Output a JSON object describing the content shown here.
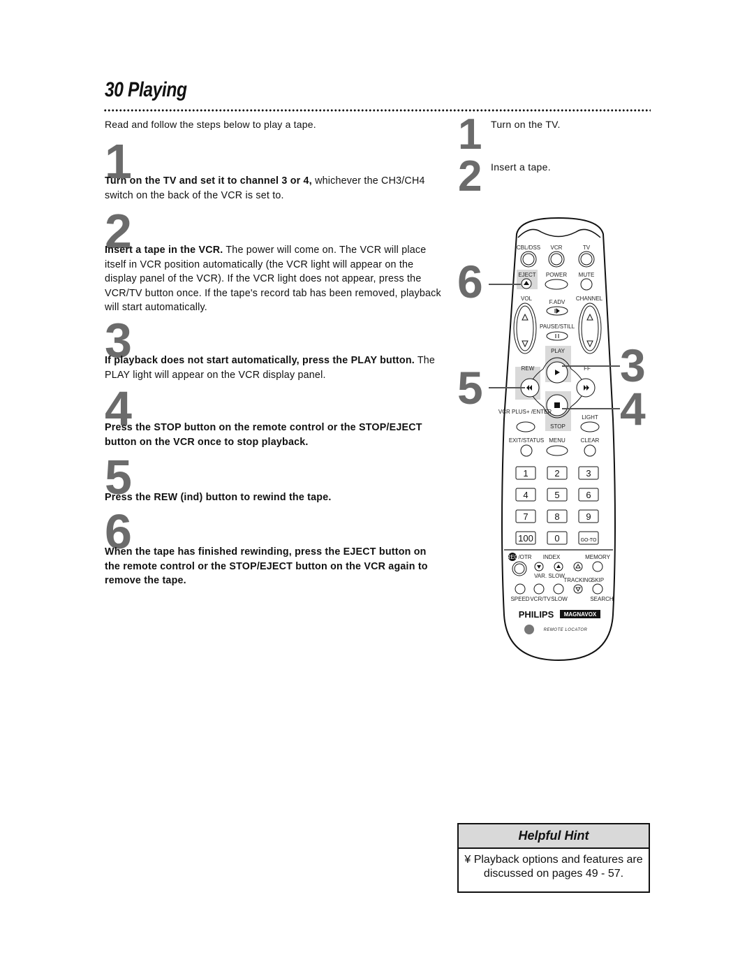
{
  "page": {
    "title": "30  Playing",
    "intro": "Read and follow the steps below to play a tape."
  },
  "steps": [
    {
      "number": "1",
      "bold": "Turn on the TV and set it to channel 3 or 4,",
      "text": " whichever the CH3/CH4 switch on the back of the VCR is set to."
    },
    {
      "number": "2",
      "bold": "Insert a tape in the VCR.",
      "text": " The power will come on. The VCR will place itself in VCR position automatically (the VCR light will appear on the display panel of the VCR). If the VCR light does not appear, press the VCR/TV button once. If the tape's record tab has been removed, playback will start automatically."
    },
    {
      "number": "3",
      "bold": "If playback does not start automatically, press the PLAY button.",
      "text": " The PLAY light will appear on the VCR display panel."
    },
    {
      "number": "4",
      "bold": "Press the STOP button on the remote control or the STOP/EJECT button on the VCR once to stop playback.",
      "text": ""
    },
    {
      "number": "5",
      "bold": "Press the REW (ind) button to rewind the tape.",
      "text": ""
    },
    {
      "number": "6",
      "bold": "When the tape has finished rewinding, press the EJECT button on the remote control or the STOP/EJECT button on the VCR again to remove the tape.",
      "text": ""
    }
  ],
  "quick_steps": [
    {
      "number": "1",
      "text": "Turn on the TV."
    },
    {
      "number": "2",
      "text": "Insert a tape."
    }
  ],
  "callouts": {
    "eject": "6",
    "play": "3",
    "rew": "5",
    "stop": "4"
  },
  "remote": {
    "source_buttons": [
      "CBL/DSS",
      "VCR",
      "TV"
    ],
    "row2": [
      "EJECT",
      "POWER",
      "MUTE"
    ],
    "vol": "VOL",
    "channel": "CHANNEL",
    "fadv": "F.ADV",
    "pause": "PAUSE/STILL",
    "play": "PLAY",
    "rew": "REW",
    "ff": "FF",
    "stop": "STOP",
    "vcrplus": "VCR PLUS+ /ENTER",
    "light": "LIGHT",
    "exit": "EXIT/STATUS",
    "menu": "MENU",
    "clear": "CLEAR",
    "keypad": [
      "1",
      "2",
      "3",
      "4",
      "5",
      "6",
      "7",
      "8",
      "9",
      "100",
      "0",
      "GO-TO"
    ],
    "rec": "REC",
    "otr": "/OTR",
    "index": "INDEX",
    "memory": "MEMORY",
    "varslow": "VAR. SLOW",
    "tracking": "TRACKING",
    "skip": "SKIP",
    "bottom_labels": [
      "SPEED",
      "VCR/TV",
      "SLOW",
      "SEARCH"
    ],
    "brand1": "PHILIPS",
    "brand2": "MAGNAVOX",
    "locator": "REMOTE LOCATOR"
  },
  "hint": {
    "title": "Helpful Hint",
    "line1": "¥ Playback options and features are",
    "line2": "discussed on pages 49 - 57."
  }
}
